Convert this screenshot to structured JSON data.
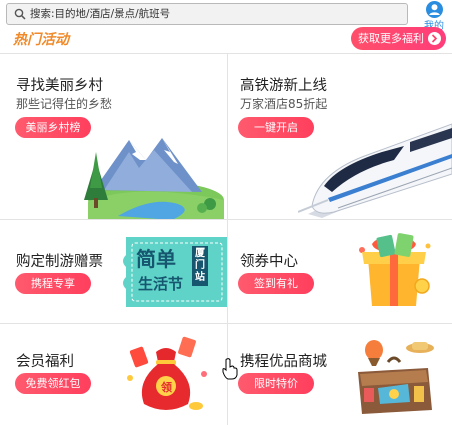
{
  "search": {
    "placeholder": "搜索:目的地/酒店/景点/航班号",
    "icon": "search-icon"
  },
  "profile": {
    "label": "我的",
    "icon": "user-icon"
  },
  "hot": {
    "title": "热门活动",
    "more_label": "获取更多福利"
  },
  "cards": [
    {
      "title": "寻找美丽乡村",
      "subtitle": "那些记得住的乡愁",
      "button": "美丽乡村榜",
      "image": "mountain-lake-illustration"
    },
    {
      "title": "高铁游新上线",
      "subtitle": "万家酒店85折起",
      "button": "一键开启",
      "image": "high-speed-train-illustration"
    },
    {
      "title": "购定制游赠票",
      "button": "携程专享",
      "image": "ticket-illustration",
      "ticket_main": "简单",
      "ticket_sub": "生活节",
      "ticket_tag": "厦门站"
    },
    {
      "title": "领券中心",
      "button": "签到有礼",
      "image": "gift-box-illustration"
    },
    {
      "title": "会员福利",
      "button": "免费领红包",
      "image": "red-envelope-bag-illustration",
      "bag_char": "领"
    },
    {
      "title": "携程优品商城",
      "button": "限时特价",
      "image": "suitcase-illustration"
    }
  ],
  "colors": {
    "accent": "#ff4a66",
    "hot_title": "#f08a2a",
    "ticket": "#5fd3c8",
    "profile": "#2b8de0"
  }
}
